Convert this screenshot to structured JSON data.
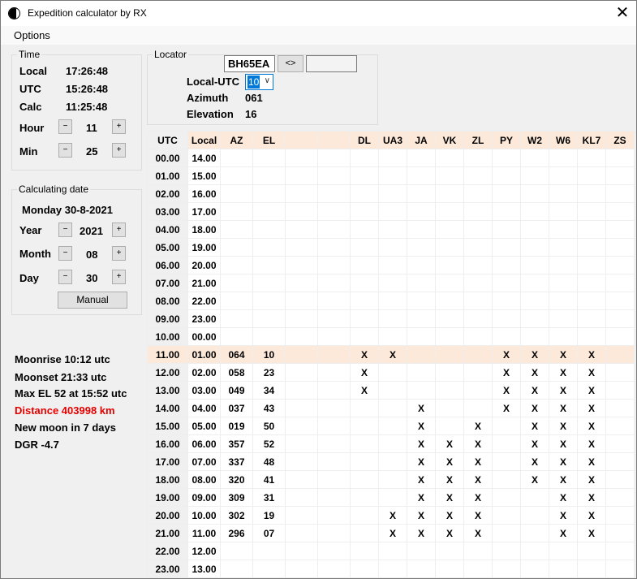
{
  "window": {
    "title": "Expedition calculator by RX",
    "close_icon": "✕"
  },
  "menu": {
    "options": "Options"
  },
  "time": {
    "legend": "Time",
    "local_label": "Local",
    "local_value": "17:26:48",
    "utc_label": "UTC",
    "utc_value": "15:26:48",
    "calc_label": "Calc",
    "calc_value": "11:25:48",
    "hour_label": "Hour",
    "hour_value": "11",
    "min_label": "Min",
    "min_value": "25",
    "minus": "−",
    "plus": "+"
  },
  "date": {
    "legend": "Calculating date",
    "display": "Monday 30-8-2021",
    "year_label": "Year",
    "year_value": "2021",
    "month_label": "Month",
    "month_value": "08",
    "day_label": "Day",
    "day_value": "30",
    "manual_button": "Manual"
  },
  "moon": {
    "moonrise": "Moonrise 10:12 utc",
    "moonset": "Moonset 21:33 utc",
    "max_el": "Max EL 52 at 15:52 utc",
    "distance": "Distance 403998 km",
    "new_moon": "New moon in 7 days",
    "dgr": "DGR -4.7"
  },
  "locator": {
    "legend": "Locator",
    "value": "BH65EA",
    "swap_button": "<>",
    "local_utc_label": "Local-UTC",
    "local_utc_value": "10",
    "azimuth_label": "Azimuth",
    "azimuth_value": "061",
    "elevation_label": "Elevation",
    "elevation_value": "16"
  },
  "colors": {
    "highlight": "#fde9d9",
    "distance": "#e60000",
    "select_accent": "#0078d7"
  },
  "table": {
    "headers": [
      "UTC",
      "Local",
      "AZ",
      "EL",
      "",
      "",
      "DL",
      "UA3",
      "JA",
      "VK",
      "ZL",
      "PY",
      "W2",
      "W6",
      "KL7",
      "ZS"
    ],
    "highlight_utc": "11.00",
    "rows": [
      [
        "00.00",
        "14.00",
        "",
        "",
        "",
        "",
        "",
        "",
        "",
        "",
        "",
        "",
        "",
        "",
        "",
        ""
      ],
      [
        "01.00",
        "15.00",
        "",
        "",
        "",
        "",
        "",
        "",
        "",
        "",
        "",
        "",
        "",
        "",
        "",
        ""
      ],
      [
        "02.00",
        "16.00",
        "",
        "",
        "",
        "",
        "",
        "",
        "",
        "",
        "",
        "",
        "",
        "",
        "",
        ""
      ],
      [
        "03.00",
        "17.00",
        "",
        "",
        "",
        "",
        "",
        "",
        "",
        "",
        "",
        "",
        "",
        "",
        "",
        ""
      ],
      [
        "04.00",
        "18.00",
        "",
        "",
        "",
        "",
        "",
        "",
        "",
        "",
        "",
        "",
        "",
        "",
        "",
        ""
      ],
      [
        "05.00",
        "19.00",
        "",
        "",
        "",
        "",
        "",
        "",
        "",
        "",
        "",
        "",
        "",
        "",
        "",
        ""
      ],
      [
        "06.00",
        "20.00",
        "",
        "",
        "",
        "",
        "",
        "",
        "",
        "",
        "",
        "",
        "",
        "",
        "",
        ""
      ],
      [
        "07.00",
        "21.00",
        "",
        "",
        "",
        "",
        "",
        "",
        "",
        "",
        "",
        "",
        "",
        "",
        "",
        ""
      ],
      [
        "08.00",
        "22.00",
        "",
        "",
        "",
        "",
        "",
        "",
        "",
        "",
        "",
        "",
        "",
        "",
        "",
        ""
      ],
      [
        "09.00",
        "23.00",
        "",
        "",
        "",
        "",
        "",
        "",
        "",
        "",
        "",
        "",
        "",
        "",
        "",
        ""
      ],
      [
        "10.00",
        "00.00",
        "",
        "",
        "",
        "",
        "",
        "",
        "",
        "",
        "",
        "",
        "",
        "",
        "",
        ""
      ],
      [
        "11.00",
        "01.00",
        "064",
        "10",
        "",
        "",
        "X",
        "X",
        "",
        "",
        "",
        "X",
        "X",
        "X",
        "X",
        ""
      ],
      [
        "12.00",
        "02.00",
        "058",
        "23",
        "",
        "",
        "X",
        "",
        "",
        "",
        "",
        "X",
        "X",
        "X",
        "X",
        ""
      ],
      [
        "13.00",
        "03.00",
        "049",
        "34",
        "",
        "",
        "X",
        "",
        "",
        "",
        "",
        "X",
        "X",
        "X",
        "X",
        ""
      ],
      [
        "14.00",
        "04.00",
        "037",
        "43",
        "",
        "",
        "",
        "",
        "X",
        "",
        "",
        "X",
        "X",
        "X",
        "X",
        ""
      ],
      [
        "15.00",
        "05.00",
        "019",
        "50",
        "",
        "",
        "",
        "",
        "X",
        "",
        "X",
        "",
        "X",
        "X",
        "X",
        ""
      ],
      [
        "16.00",
        "06.00",
        "357",
        "52",
        "",
        "",
        "",
        "",
        "X",
        "X",
        "X",
        "",
        "X",
        "X",
        "X",
        ""
      ],
      [
        "17.00",
        "07.00",
        "337",
        "48",
        "",
        "",
        "",
        "",
        "X",
        "X",
        "X",
        "",
        "X",
        "X",
        "X",
        ""
      ],
      [
        "18.00",
        "08.00",
        "320",
        "41",
        "",
        "",
        "",
        "",
        "X",
        "X",
        "X",
        "",
        "X",
        "X",
        "X",
        ""
      ],
      [
        "19.00",
        "09.00",
        "309",
        "31",
        "",
        "",
        "",
        "",
        "X",
        "X",
        "X",
        "",
        "",
        "X",
        "X",
        ""
      ],
      [
        "20.00",
        "10.00",
        "302",
        "19",
        "",
        "",
        "",
        "X",
        "X",
        "X",
        "X",
        "",
        "",
        "X",
        "X",
        ""
      ],
      [
        "21.00",
        "11.00",
        "296",
        "07",
        "",
        "",
        "",
        "X",
        "X",
        "X",
        "X",
        "",
        "",
        "X",
        "X",
        ""
      ],
      [
        "22.00",
        "12.00",
        "",
        "",
        "",
        "",
        "",
        "",
        "",
        "",
        "",
        "",
        "",
        "",
        "",
        ""
      ],
      [
        "23.00",
        "13.00",
        "",
        "",
        "",
        "",
        "",
        "",
        "",
        "",
        "",
        "",
        "",
        "",
        "",
        ""
      ]
    ]
  }
}
